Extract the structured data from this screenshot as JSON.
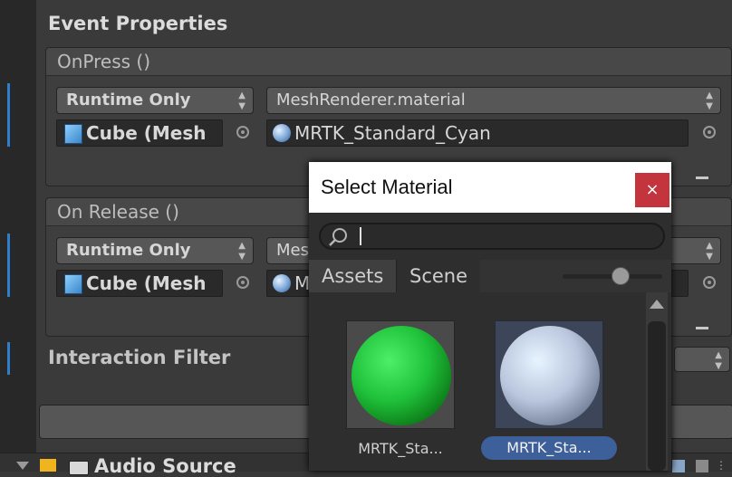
{
  "inspector": {
    "event_properties_title": "Event Properties",
    "on_press": {
      "header": "OnPress ()",
      "call_state": "Runtime Only",
      "function": "MeshRenderer.material",
      "target": "Cube (Mesh",
      "argument": "MRTK_Standard_Cyan"
    },
    "on_release": {
      "header": "On Release ()",
      "call_state": "Runtime Only",
      "function": "Mesh",
      "target": "Cube (Mesh",
      "argument": "M"
    },
    "interaction_filter_title": "Interaction Filter",
    "audio_source_label": "Audio Source"
  },
  "popup": {
    "title": "Select Material",
    "close_icon": "×",
    "search_placeholder": "",
    "tabs": [
      {
        "label": "Assets",
        "active": false
      },
      {
        "label": "Scene",
        "active": true
      }
    ],
    "thumbnail_size_slider": 0.58,
    "items": [
      {
        "label": "MRTK_Sta...",
        "color": "#1fc03a",
        "selected": false
      },
      {
        "label": "MRTK_Sta...",
        "color": "#b9c6dd",
        "selected": true
      }
    ]
  },
  "colors": {
    "accent": "#2f7fc8",
    "close": "#c4343c",
    "selection": "#3d5f9a"
  }
}
